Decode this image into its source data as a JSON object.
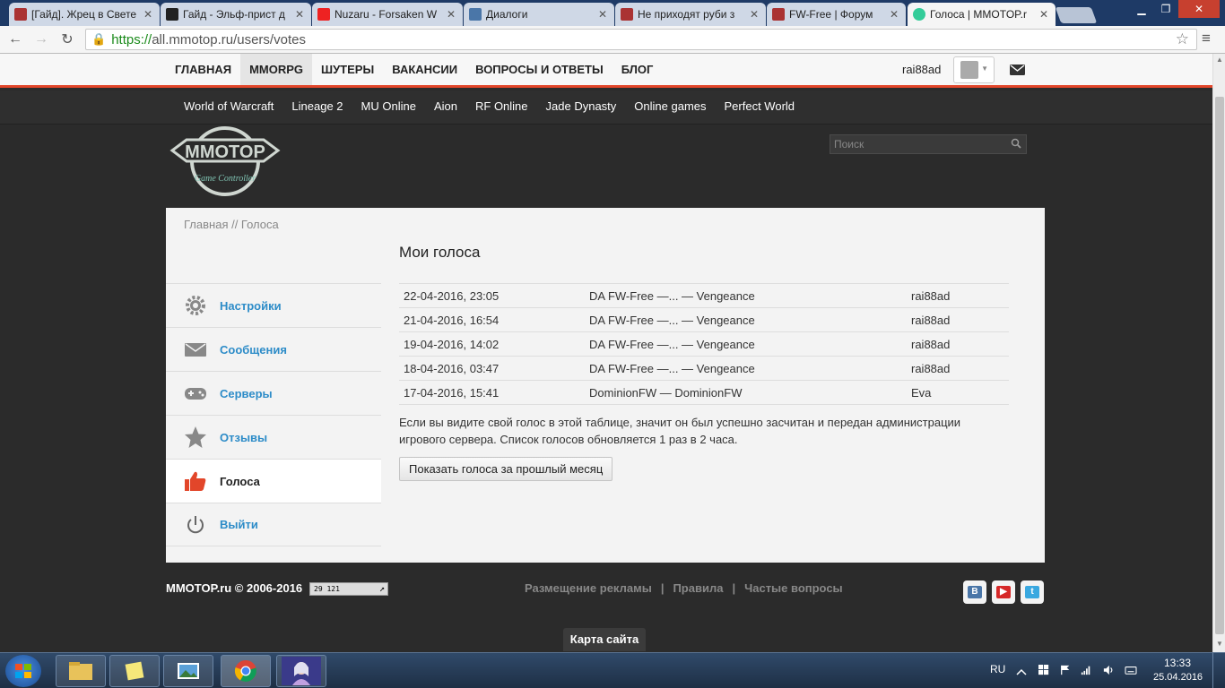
{
  "browser": {
    "tabs": [
      {
        "title": "[Гайд]. Жрец в Свете",
        "active": false
      },
      {
        "title": "Гайд - Эльф-прист д",
        "active": false
      },
      {
        "title": "Nuzaru - Forsaken W",
        "active": false
      },
      {
        "title": "Диалоги",
        "active": false
      },
      {
        "title": "Не приходят руби з",
        "active": false
      },
      {
        "title": "FW-Free | Форум",
        "active": false
      },
      {
        "title": "Голоса | MMOTOP.r",
        "active": true
      }
    ],
    "url_https": "https://",
    "url_rest": "all.mmotop.ru/users/votes"
  },
  "topnav": {
    "items": [
      "ГЛАВНАЯ",
      "MMORPG",
      "ШУТЕРЫ",
      "ВАКАНСИИ",
      "ВОПРОСЫ И ОТВЕТЫ",
      "БЛОГ"
    ],
    "active_index": 1,
    "username": "rai88ad"
  },
  "gamenav": {
    "items": [
      "World of Warcraft",
      "Lineage 2",
      "MU Online",
      "Aion",
      "RF Online",
      "Jade Dynasty",
      "Online games",
      "Perfect World"
    ]
  },
  "logo": {
    "text": "MMOTOP",
    "tagline": "Game Controller"
  },
  "search": {
    "placeholder": "Поиск"
  },
  "breadcrumb": "Главная // Голоса",
  "sidebar": {
    "items": [
      {
        "label": "Настройки",
        "icon": "gear-icon"
      },
      {
        "label": "Сообщения",
        "icon": "envelope-icon"
      },
      {
        "label": "Серверы",
        "icon": "gamepad-icon"
      },
      {
        "label": "Отзывы",
        "icon": "star-icon"
      },
      {
        "label": "Голоса",
        "icon": "thumbs-up-icon",
        "active": true
      },
      {
        "label": "Выйти",
        "icon": "power-icon"
      }
    ]
  },
  "main": {
    "title": "Мои голоса",
    "votes": [
      {
        "date": "22-04-2016, 23:05",
        "server": "DA FW-Free —... — Vengeance",
        "user": "rai88ad"
      },
      {
        "date": "21-04-2016, 16:54",
        "server": "DA FW-Free —... — Vengeance",
        "user": "rai88ad"
      },
      {
        "date": "19-04-2016, 14:02",
        "server": "DA FW-Free —... — Vengeance",
        "user": "rai88ad"
      },
      {
        "date": "18-04-2016, 03:47",
        "server": "DA FW-Free —... — Vengeance",
        "user": "rai88ad"
      },
      {
        "date": "17-04-2016, 15:41",
        "server": "DominionFW — DominionFW",
        "user": "Eva"
      }
    ],
    "notice": "Если вы видите свой голос в этой таблице, значит он был успешно засчитан и передан администрации игрового сервера. Список голосов обновляется 1 раз в 2 часа.",
    "button": "Показать голоса за прошлый месяц"
  },
  "footer": {
    "copyright": "MMOTOP.ru © 2006-2016",
    "counter": "29 121",
    "links": [
      "Размещение рекламы",
      "Правила",
      "Частые вопросы"
    ],
    "sitemap": "Карта сайта"
  },
  "taskbar": {
    "lang": "RU",
    "time": "13:33",
    "date": "25.04.2016"
  },
  "colors": {
    "accent": "#e2462a",
    "link": "#2d8cc8"
  }
}
